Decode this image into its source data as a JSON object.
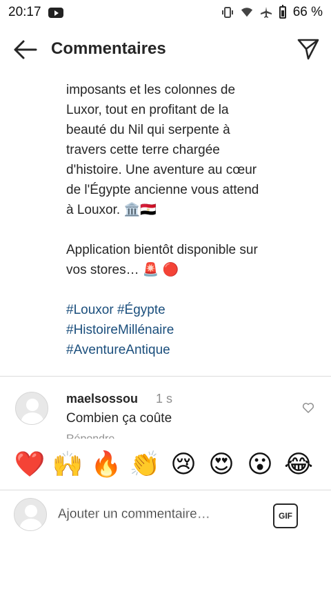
{
  "status_bar": {
    "time": "20:17",
    "battery_percent": "66 %",
    "icons": [
      "youtube-icon",
      "vibrate-icon",
      "wifi-icon",
      "airplane-icon",
      "battery-icon"
    ]
  },
  "app_bar": {
    "title": "Commentaires",
    "back_icon": "back-arrow-icon",
    "send_icon": "send-icon"
  },
  "post": {
    "lines": [
      "imposants et les colonnes de",
      "Luxor, tout en profitant de la",
      "beauté du Nil qui serpente à",
      "travers cette terre chargée",
      "d'histoire. Une aventure au cœur",
      "de l'Égypte ancienne vous attend",
      "à Louxor."
    ],
    "line_emojis": [
      "🏛️",
      "🇪🇬"
    ],
    "app_line_1": "Application bientôt disponible sur",
    "app_line_2": "vos stores…",
    "app_emojis": [
      "🚨",
      "🔴"
    ],
    "hashtags": [
      "#Louxor",
      "#Égypte",
      "#HistoireMillénaire",
      "#AventureAntique"
    ]
  },
  "comment": {
    "username": "maelsossou",
    "time": "1 s",
    "text": "Combien ça coûte",
    "reply_label": "Répondre"
  },
  "reactions": [
    "❤️",
    "🙌",
    "🔥",
    "👏",
    "😢",
    "😍",
    "😮",
    "😂"
  ],
  "composer": {
    "placeholder": "Ajouter un commentaire…",
    "gif_label": "GIF"
  },
  "colors": {
    "hashtag": "#1a4e7c",
    "text": "#262626",
    "muted": "#8e8e8e",
    "divider": "#dbdbdb"
  }
}
